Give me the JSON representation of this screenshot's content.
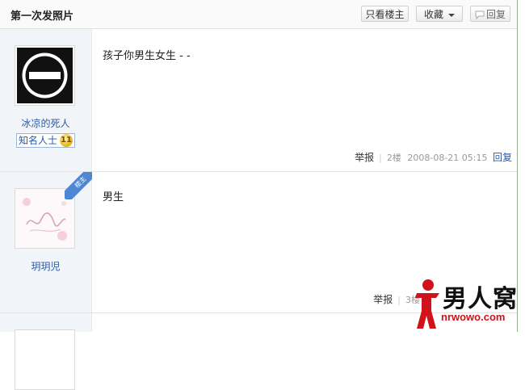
{
  "header": {
    "title": "第一次发照片",
    "only_owner_label": "只看楼主",
    "favorite_label": "收藏",
    "reply_label": "回复"
  },
  "posts": [
    {
      "username": "冰凉的死人",
      "rank": "知名人士",
      "rank_level": "11",
      "content": "孩子你男生女生 - -",
      "report_label": "举报",
      "floor": "2楼",
      "time": "2008-08-21 05:15",
      "reply_label": "回复"
    },
    {
      "badge": "楼主",
      "username": "玥玥児",
      "content": "男生",
      "report_label": "举报",
      "floor": "3楼"
    }
  ],
  "watermark": {
    "title": "男人窝",
    "url": "nrwowo.com"
  },
  "colors": {
    "link_blue": "#2a5aa5",
    "side_bg": "#f1f5fa",
    "badge_blue": "#4f86d4",
    "watermark_red": "#d0121b"
  }
}
